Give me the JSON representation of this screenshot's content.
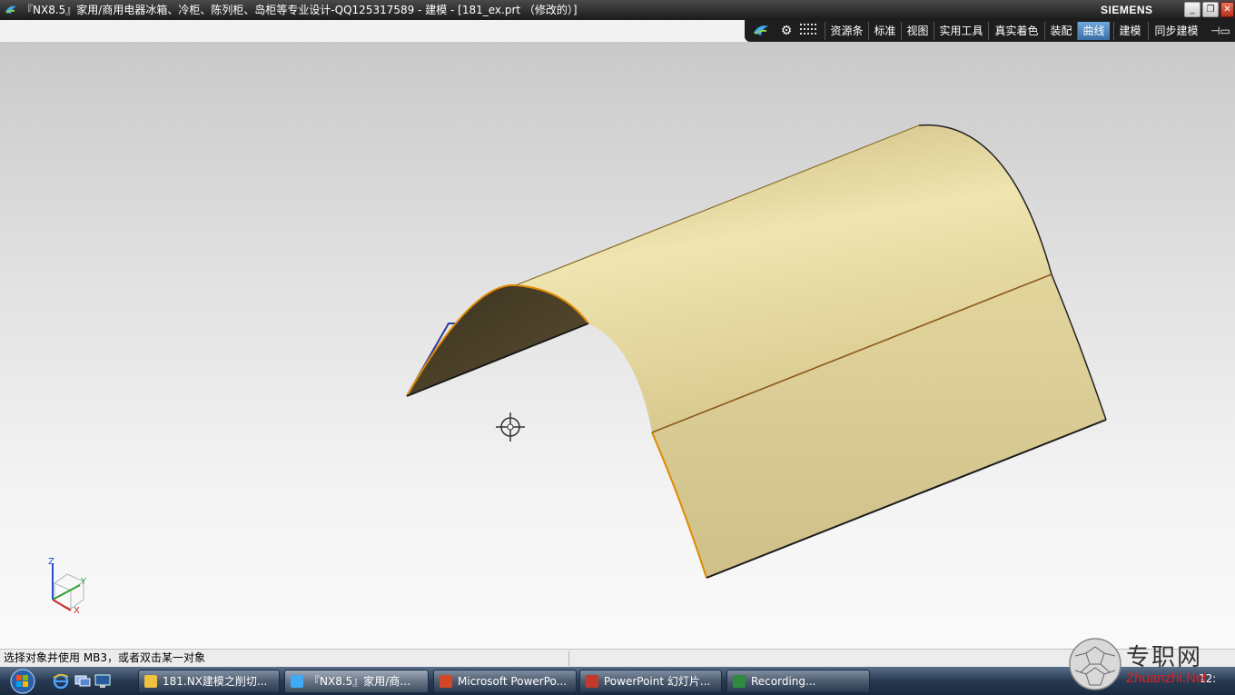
{
  "window": {
    "title": "『NX8.5』家用/商用电器冰箱、冷柜、陈列柜、岛柜等专业设计-QQ125317589 - 建模 - [181_ex.prt （修改的）]",
    "brand": "SIEMENS",
    "controls": [
      "_",
      "❐",
      "✕"
    ]
  },
  "menubar": {
    "icons": [
      "bird-icon",
      "gear-icon",
      "grid-icon"
    ],
    "tabs": [
      {
        "label": "资源条"
      },
      {
        "label": "标准"
      },
      {
        "label": "视图"
      },
      {
        "label": "实用工具"
      },
      {
        "label": "真实着色"
      },
      {
        "label": "装配"
      },
      {
        "label": "曲线",
        "active": true
      },
      {
        "label": "建模"
      },
      {
        "label": "同步建模"
      }
    ]
  },
  "viewport": {
    "triad": {
      "z": "Z",
      "y": "Y",
      "x": "X"
    },
    "colors": {
      "surface": "#e6d9a0",
      "edge_highlight": "#e08a00",
      "background_top": "#c9c9c9"
    }
  },
  "status": {
    "prompt": "选择对象并使用 MB3，或者双击某一对象"
  },
  "taskbar": {
    "tasks": [
      {
        "label": "181.NX建模之削切...",
        "icon": "folder-icon"
      },
      {
        "label": "『NX8.5』家用/商...",
        "icon": "nx-icon",
        "active": true
      },
      {
        "label": "Microsoft PowerPo...",
        "icon": "powerpoint-icon"
      },
      {
        "label": "PowerPoint 幻灯片...",
        "icon": "slideshow-icon"
      },
      {
        "label": "Recording...",
        "icon": "recording-icon"
      }
    ],
    "clock": "12:"
  },
  "watermark": {
    "cn": "专职网",
    "en": "Zhuanzhi.Net"
  }
}
